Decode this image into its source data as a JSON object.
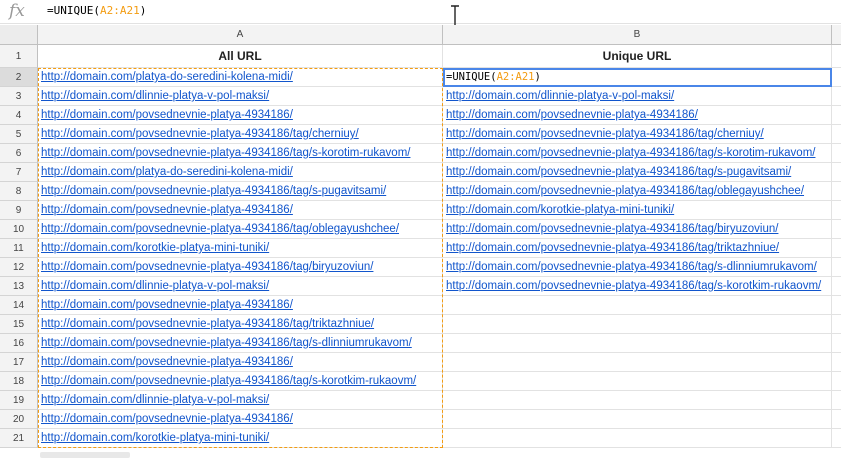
{
  "formula_bar": {
    "fx_label": "fx",
    "prefix": "=UNIQUE(",
    "range": "A2:A21",
    "suffix": ")"
  },
  "columns": [
    "A",
    "B"
  ],
  "header_row": {
    "row": "1",
    "a": "All URL",
    "b": "Unique URL"
  },
  "editing_cell": {
    "prefix": "=UNIQUE(",
    "range": "A2:A21",
    "suffix": ")"
  },
  "rows": [
    {
      "n": "2",
      "a": "http://domain.com/platya-do-seredini-kolena-midi/",
      "b": ""
    },
    {
      "n": "3",
      "a": "http://domain.com/dlinnie-platya-v-pol-maksi/",
      "b": "http://domain.com/dlinnie-platya-v-pol-maksi/"
    },
    {
      "n": "4",
      "a": "http://domain.com/povsednevnie-platya-4934186/",
      "b": "http://domain.com/povsednevnie-platya-4934186/"
    },
    {
      "n": "5",
      "a": "http://domain.com/povsednevnie-platya-4934186/tag/cherniuy/",
      "b": "http://domain.com/povsednevnie-platya-4934186/tag/cherniuy/"
    },
    {
      "n": "6",
      "a": "http://domain.com/povsednevnie-platya-4934186/tag/s-korotim-rukavom/",
      "b": "http://domain.com/povsednevnie-platya-4934186/tag/s-korotim-rukavom/"
    },
    {
      "n": "7",
      "a": "http://domain.com/platya-do-seredini-kolena-midi/",
      "b": "http://domain.com/povsednevnie-platya-4934186/tag/s-pugavitsami/"
    },
    {
      "n": "8",
      "a": "http://domain.com/povsednevnie-platya-4934186/tag/s-pugavitsami/",
      "b": "http://domain.com/povsednevnie-platya-4934186/tag/oblegayushchee/"
    },
    {
      "n": "9",
      "a": "http://domain.com/povsednevnie-platya-4934186/",
      "b": "http://domain.com/korotkie-platya-mini-tuniki/"
    },
    {
      "n": "10",
      "a": "http://domain.com/povsednevnie-platya-4934186/tag/oblegayushchee/",
      "b": "http://domain.com/povsednevnie-platya-4934186/tag/biryuzoviun/"
    },
    {
      "n": "11",
      "a": "http://domain.com/korotkie-platya-mini-tuniki/",
      "b": "http://domain.com/povsednevnie-platya-4934186/tag/triktazhniue/"
    },
    {
      "n": "12",
      "a": "http://domain.com/povsednevnie-platya-4934186/tag/biryuzoviun/",
      "b": "http://domain.com/povsednevnie-platya-4934186/tag/s-dlinniumrukavom/"
    },
    {
      "n": "13",
      "a": "http://domain.com/dlinnie-platya-v-pol-maksi/",
      "b": "http://domain.com/povsednevnie-platya-4934186/tag/s-korotkim-rukaovm/"
    },
    {
      "n": "14",
      "a": "http://domain.com/povsednevnie-platya-4934186/",
      "b": ""
    },
    {
      "n": "15",
      "a": "http://domain.com/povsednevnie-platya-4934186/tag/triktazhniue/",
      "b": ""
    },
    {
      "n": "16",
      "a": "http://domain.com/povsednevnie-platya-4934186/tag/s-dlinniumrukavom/",
      "b": ""
    },
    {
      "n": "17",
      "a": "http://domain.com/povsednevnie-platya-4934186/",
      "b": ""
    },
    {
      "n": "18",
      "a": "http://domain.com/povsednevnie-platya-4934186/tag/s-korotkim-rukaovm/",
      "b": ""
    },
    {
      "n": "19",
      "a": "http://domain.com/dlinnie-platya-v-pol-maksi/",
      "b": ""
    },
    {
      "n": "20",
      "a": "http://domain.com/povsednevnie-platya-4934186/",
      "b": ""
    },
    {
      "n": "21",
      "a": "http://domain.com/korotkie-platya-mini-tuniki/",
      "b": ""
    }
  ],
  "colors": {
    "link": "#1155cc",
    "range_highlight": "#f39c12",
    "selection": "#4a86e8"
  },
  "icons": {
    "cursor": "text-cursor-icon"
  }
}
